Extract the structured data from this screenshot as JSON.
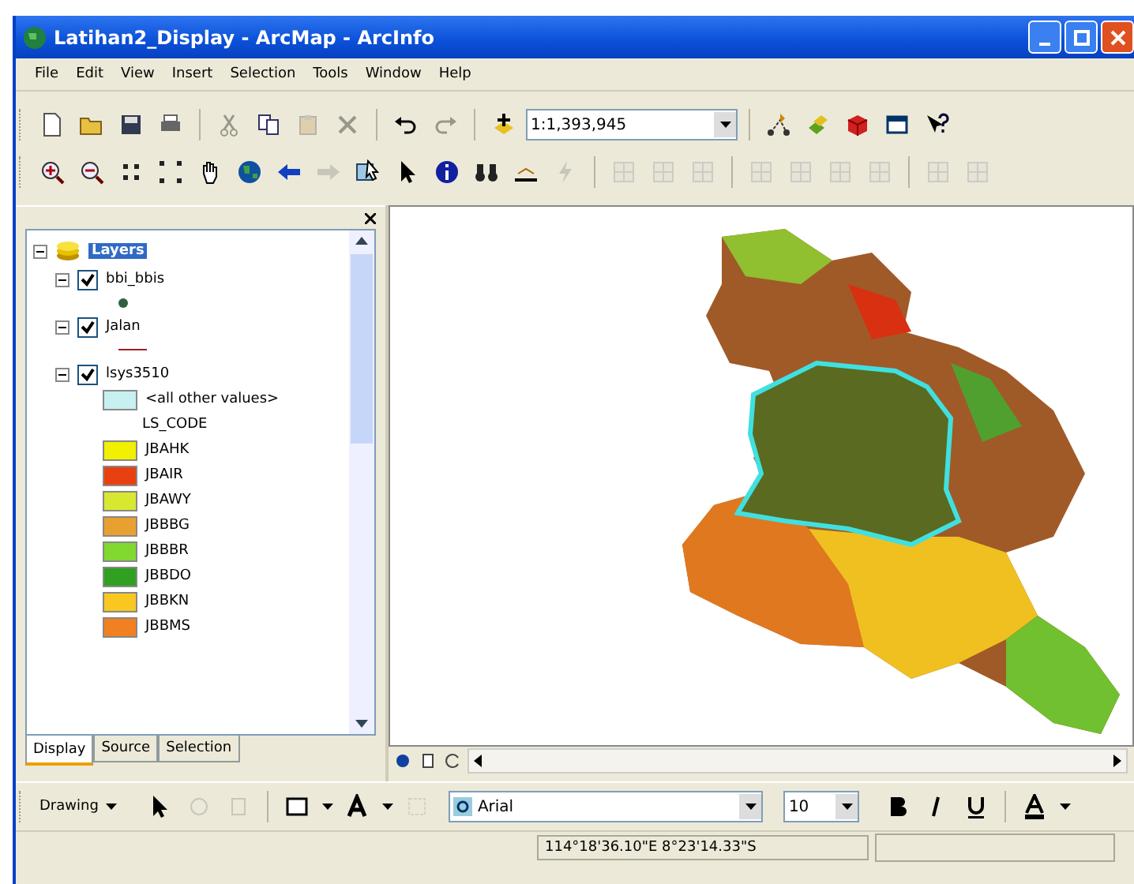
{
  "window": {
    "title": "Latihan2_Display - ArcMap - ArcInfo"
  },
  "menu": [
    "File",
    "Edit",
    "View",
    "Insert",
    "Selection",
    "Tools",
    "Window",
    "Help"
  ],
  "toolbars": [
    [
      {
        "kind": "new",
        "disabled": false
      },
      {
        "kind": "open",
        "disabled": false
      },
      {
        "kind": "save",
        "disabled": false
      },
      {
        "kind": "print",
        "disabled": false
      },
      {
        "kind": "sep"
      },
      {
        "kind": "cut",
        "disabled": true
      },
      {
        "kind": "copy",
        "disabled": false
      },
      {
        "kind": "paste",
        "disabled": true
      },
      {
        "kind": "delete",
        "disabled": true
      },
      {
        "kind": "sep"
      },
      {
        "kind": "undo",
        "disabled": false
      },
      {
        "kind": "redo",
        "disabled": true
      },
      {
        "kind": "sep"
      },
      {
        "kind": "add",
        "disabled": false
      },
      {
        "kind": "scale",
        "value": "1:1,393,945"
      },
      {
        "kind": "sep"
      },
      {
        "kind": "edit",
        "disabled": false
      },
      {
        "kind": "layers",
        "disabled": false
      },
      {
        "kind": "cube",
        "disabled": false
      },
      {
        "kind": "window",
        "disabled": false
      },
      {
        "kind": "help",
        "disabled": false
      }
    ],
    [
      {
        "kind": "zoomin",
        "disabled": false
      },
      {
        "kind": "zoomout",
        "disabled": false
      },
      {
        "kind": "fixin",
        "disabled": false
      },
      {
        "kind": "fixout",
        "disabled": false
      },
      {
        "kind": "pan",
        "disabled": false
      },
      {
        "kind": "globe",
        "disabled": false
      },
      {
        "kind": "back",
        "disabled": false
      },
      {
        "kind": "forward",
        "disabled": true
      },
      {
        "kind": "select",
        "disabled": false
      },
      {
        "kind": "pointer",
        "disabled": false
      },
      {
        "kind": "info",
        "disabled": false
      },
      {
        "kind": "find",
        "disabled": false
      },
      {
        "kind": "measure",
        "disabled": false
      },
      {
        "kind": "bolt",
        "disabled": true
      },
      {
        "kind": "sep"
      },
      {
        "kind": "grid",
        "disabled": true
      },
      {
        "kind": "grid",
        "disabled": true
      },
      {
        "kind": "grid",
        "disabled": true
      },
      {
        "kind": "sep"
      },
      {
        "kind": "grid",
        "disabled": true
      },
      {
        "kind": "grid",
        "disabled": true
      },
      {
        "kind": "grid",
        "disabled": true
      },
      {
        "kind": "grid",
        "disabled": true
      },
      {
        "kind": "sep"
      },
      {
        "kind": "grid",
        "disabled": true
      },
      {
        "kind": "grid",
        "disabled": true
      }
    ]
  ],
  "toc": {
    "label": "Layers",
    "selected": true,
    "expanded": true,
    "children": [
      {
        "label": "bbi_bbis",
        "checked": true,
        "expanded": true,
        "symbol": {
          "kind": "point"
        }
      },
      {
        "label": "Jalan",
        "checked": true,
        "expanded": true,
        "symbol": {
          "kind": "line"
        }
      },
      {
        "label": "lsys3510",
        "checked": true,
        "expanded": true,
        "symbol": {
          "kind": "values",
          "other": {
            "label": "<all other values>",
            "color": "#c8f0f0"
          },
          "field": "LS_CODE",
          "classes": [
            {
              "label": "JBAHK",
              "color": "#f0f000"
            },
            {
              "label": "JBAIR",
              "color": "#e84010"
            },
            {
              "label": "JBAWY",
              "color": "#d8e830"
            },
            {
              "label": "JBBBG",
              "color": "#e8a030"
            },
            {
              "label": "JBBBR",
              "color": "#80d830"
            },
            {
              "label": "JBBDO",
              "color": "#30a020"
            },
            {
              "label": "JBBKN",
              "color": "#f8c820"
            },
            {
              "label": "JBBMS",
              "color": "#f08020"
            }
          ]
        }
      }
    ]
  },
  "toc_tabs": [
    {
      "label": "Display",
      "selected": true
    },
    {
      "label": "Source",
      "selected": false
    },
    {
      "label": "Selection",
      "selected": false
    }
  ],
  "drawing_toolbar": {
    "menu": "Drawing",
    "font": "Arial",
    "size": "10"
  },
  "status_bar": {
    "coordinates": "114°18'36.10\"E  8°23'14.33\"S"
  }
}
